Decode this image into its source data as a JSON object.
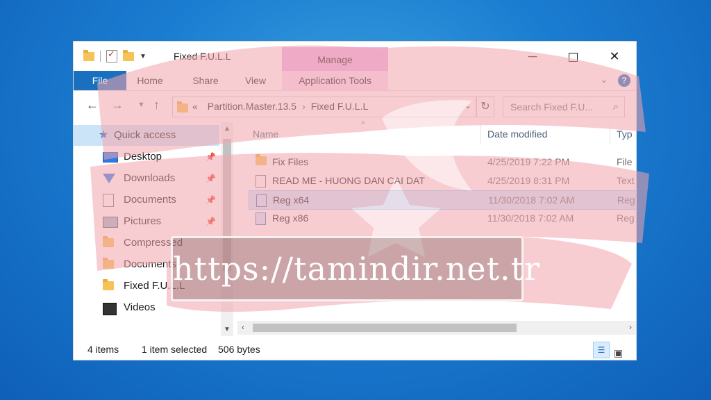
{
  "window": {
    "title": "Fixed F.U.L.L",
    "context_tab_group": "Manage"
  },
  "ribbon": {
    "tabs": [
      "File",
      "Home",
      "Share",
      "View",
      "Application Tools"
    ]
  },
  "address": {
    "overflow": "«",
    "crumbs": [
      "Partition.Master.13.5",
      "Fixed F.U.L.L"
    ],
    "search_placeholder": "Search Fixed F.U..."
  },
  "nav": {
    "quick_access": "Quick access",
    "items": [
      {
        "label": "Desktop",
        "icon": "desktop-icon",
        "pinned": true
      },
      {
        "label": "Downloads",
        "icon": "downloads-icon",
        "pinned": true
      },
      {
        "label": "Documents",
        "icon": "documents-icon",
        "pinned": true
      },
      {
        "label": "Pictures",
        "icon": "pictures-icon",
        "pinned": true
      },
      {
        "label": "Compressed",
        "icon": "folder-icon",
        "pinned": false
      },
      {
        "label": "Documents",
        "icon": "folder-icon",
        "pinned": false
      },
      {
        "label": "Fixed F.U.L.L",
        "icon": "folder-icon",
        "pinned": false
      },
      {
        "label": "Videos",
        "icon": "videos-icon",
        "pinned": false
      }
    ]
  },
  "list": {
    "columns": [
      "Name",
      "Date modified",
      "Typ"
    ],
    "rows": [
      {
        "name": "Fix Files",
        "date": "4/25/2019 7:22 PM",
        "type": "File",
        "icon": "folder-icon",
        "selected": false
      },
      {
        "name": "READ ME - HUONG DAN CAI DAT",
        "date": "4/25/2019 8:31 PM",
        "type": "Text",
        "icon": "text-file-icon",
        "selected": false
      },
      {
        "name": "Reg x64",
        "date": "11/30/2018 7:02 AM",
        "type": "Reg",
        "icon": "registry-file-icon",
        "selected": true
      },
      {
        "name": "Reg x86",
        "date": "11/30/2018 7:02 AM",
        "type": "Reg",
        "icon": "registry-file-icon",
        "selected": false
      }
    ]
  },
  "status": {
    "count": "4 items",
    "selection": "1 item selected",
    "size": "506 bytes"
  },
  "watermark": {
    "text": "https://tamindir.net.tr"
  },
  "colors": {
    "accent": "#1b6fbf",
    "manage_tab": "#ebb0e3",
    "brush": "#f4a6ae",
    "selection": "#cde8ff"
  }
}
